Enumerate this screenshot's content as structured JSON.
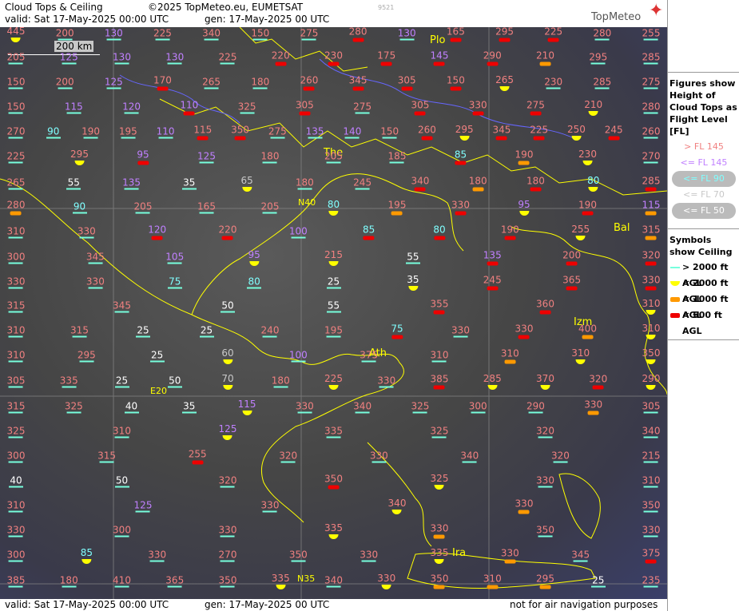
{
  "header": {
    "title": "Cloud Tops & Ceiling",
    "copyright": "©2025 TopMeteo.eu, EUMETSAT",
    "valid": "valid:  Sat  17-May-2025  00:00 UTC",
    "gen": "gen: 17-May-2025 00 UTC",
    "code": "9521",
    "brand": "TopMeteo"
  },
  "footer": {
    "valid": "valid:  Sat  17-May-2025  00:00 UTC",
    "gen": "gen: 17-May-2025 00 UTC",
    "note": "not for air navigation purposes"
  },
  "map": {
    "scale_label": "200 km",
    "cities": [
      "Plo",
      "The",
      "Ath",
      "Izm",
      "Bal",
      "Ira"
    ],
    "grid_labels": [
      "N40",
      "E20",
      "N35"
    ]
  },
  "legend": {
    "heights_title": "Figures show Height of Cloud Tops as Flight Level  [FL]",
    "heights": [
      {
        "label": "> FL 145",
        "color": "#f08080",
        "pill": false
      },
      {
        "label": "<= FL 145",
        "color": "#c080ff",
        "pill": false
      },
      {
        "label": "<= FL 90",
        "color": "#80ffff",
        "pill": true
      },
      {
        "label": "<= FL 70",
        "color": "#c8c8c8",
        "pill": false
      },
      {
        "label": "<= FL 50",
        "color": "#ffffff",
        "pill": true
      }
    ],
    "symbols_title": "Symbols show Ceiling",
    "symbols": [
      {
        "label": "> 2000 ft AGL",
        "color": "#7fd",
        "shape": "line"
      },
      {
        "label": "< 2000 ft AGL",
        "color": "#ff0",
        "shape": "dot"
      },
      {
        "label": "< 1000 ft AGL",
        "color": "#f90",
        "shape": "sq"
      },
      {
        "label": "< 500 ft AGL",
        "color": "#e00",
        "shape": "sq"
      }
    ]
  },
  "cells": [
    {
      "v": "445",
      "c": "hi",
      "s": "y"
    },
    {
      "v": "200",
      "c": "hi",
      "s": "l"
    },
    {
      "v": "130",
      "c": "mid",
      "s": "l"
    },
    {
      "v": "225",
      "c": "hi",
      "s": "l"
    },
    {
      "v": "340",
      "c": "hi",
      "s": "l"
    },
    {
      "v": "150",
      "c": "hi",
      "s": "l"
    },
    {
      "v": "275",
      "c": "hi",
      "s": "l"
    },
    {
      "v": "280",
      "c": "hi",
      "s": "r"
    },
    {
      "v": "130",
      "c": "mid",
      "s": "l"
    },
    {
      "v": "165",
      "c": "hi",
      "s": "r"
    },
    {
      "v": "295",
      "c": "hi",
      "s": "r"
    },
    {
      "v": "225",
      "c": "hi",
      "s": "r"
    },
    {
      "v": "280",
      "c": "hi",
      "s": "l"
    },
    {
      "v": "255",
      "c": "hi",
      "s": "l"
    },
    {
      "v": "205",
      "c": "hi",
      "s": "l"
    },
    {
      "v": "125",
      "c": "mid",
      "s": "l"
    },
    {
      "v": "130",
      "c": "mid",
      "s": "l"
    },
    {
      "v": "130",
      "c": "mid",
      "s": "l"
    },
    {
      "v": "225",
      "c": "hi",
      "s": "l"
    },
    {
      "v": "220",
      "c": "hi",
      "s": "r"
    },
    {
      "v": "230",
      "c": "hi",
      "s": "r"
    },
    {
      "v": "175",
      "c": "hi",
      "s": "r"
    },
    {
      "v": "145",
      "c": "mid",
      "s": "r"
    },
    {
      "v": "290",
      "c": "hi",
      "s": "r"
    },
    {
      "v": "210",
      "c": "hi",
      "s": "o"
    },
    {
      "v": "295",
      "c": "hi",
      "s": "l"
    },
    {
      "v": "285",
      "c": "hi",
      "s": "l"
    },
    {
      "v": "150",
      "c": "hi",
      "s": "l"
    },
    {
      "v": "200",
      "c": "hi",
      "s": "l"
    },
    {
      "v": "125",
      "c": "mid",
      "s": "l"
    },
    {
      "v": "170",
      "c": "hi",
      "s": "r"
    },
    {
      "v": "265",
      "c": "hi",
      "s": "l"
    },
    {
      "v": "180",
      "c": "hi",
      "s": "l"
    },
    {
      "v": "260",
      "c": "hi",
      "s": "r"
    },
    {
      "v": "345",
      "c": "hi",
      "s": "r"
    },
    {
      "v": "305",
      "c": "hi",
      "s": "r"
    },
    {
      "v": "150",
      "c": "hi",
      "s": "r"
    },
    {
      "v": "265",
      "c": "hi",
      "s": "y"
    },
    {
      "v": "230",
      "c": "hi",
      "s": "l"
    },
    {
      "v": "285",
      "c": "hi",
      "s": "l"
    },
    {
      "v": "275",
      "c": "hi",
      "s": "l"
    },
    {
      "v": "150",
      "c": "hi",
      "s": "l"
    },
    {
      "v": "115",
      "c": "mid",
      "s": "l"
    },
    {
      "v": "120",
      "c": "mid",
      "s": "l"
    },
    {
      "v": "110",
      "c": "mid",
      "s": "r"
    },
    {
      "v": "325",
      "c": "hi",
      "s": "l"
    },
    {
      "v": "305",
      "c": "hi",
      "s": "r"
    },
    {
      "v": "275",
      "c": "hi",
      "s": "l"
    },
    {
      "v": "305",
      "c": "hi",
      "s": "r"
    },
    {
      "v": "330",
      "c": "hi",
      "s": "r"
    },
    {
      "v": "275",
      "c": "hi",
      "s": "r"
    },
    {
      "v": "210",
      "c": "hi",
      "s": "y"
    },
    {
      "v": "280",
      "c": "hi",
      "s": "l"
    },
    {
      "v": "270",
      "c": "hi",
      "s": "l"
    },
    {
      "v": "90",
      "c": "low",
      "s": "l"
    },
    {
      "v": "190",
      "c": "hi",
      "s": "l"
    },
    {
      "v": "195",
      "c": "hi",
      "s": "l"
    },
    {
      "v": "110",
      "c": "mid",
      "s": "l"
    },
    {
      "v": "115",
      "c": "hi",
      "s": "r"
    },
    {
      "v": "350",
      "c": "hi",
      "s": "r"
    },
    {
      "v": "275",
      "c": "hi",
      "s": "l"
    },
    {
      "v": "135",
      "c": "mid",
      "s": "l"
    },
    {
      "v": "140",
      "c": "mid",
      "s": "l"
    },
    {
      "v": "150",
      "c": "hi",
      "s": "l"
    },
    {
      "v": "260",
      "c": "hi",
      "s": "r"
    },
    {
      "v": "295",
      "c": "hi",
      "s": "y"
    },
    {
      "v": "345",
      "c": "hi",
      "s": "r"
    },
    {
      "v": "225",
      "c": "hi",
      "s": "r"
    },
    {
      "v": "250",
      "c": "hi",
      "s": "y"
    },
    {
      "v": "245",
      "c": "hi",
      "s": "r"
    },
    {
      "v": "260",
      "c": "hi",
      "s": "l"
    },
    {
      "v": "225",
      "c": "hi",
      "s": "l"
    },
    {
      "v": "295",
      "c": "hi",
      "s": "y"
    },
    {
      "v": "95",
      "c": "mid",
      "s": "r"
    },
    {
      "v": "125",
      "c": "mid",
      "s": "l"
    },
    {
      "v": "180",
      "c": "hi",
      "s": "l"
    },
    {
      "v": "205",
      "c": "hi",
      "s": "l"
    },
    {
      "v": "185",
      "c": "hi",
      "s": "l"
    },
    {
      "v": "85",
      "c": "low",
      "s": "r"
    },
    {
      "v": "190",
      "c": "hi",
      "s": "o"
    },
    {
      "v": "230",
      "c": "hi",
      "s": "y"
    },
    {
      "v": "270",
      "c": "hi",
      "s": "l"
    },
    {
      "v": "265",
      "c": "hi",
      "s": "l"
    },
    {
      "v": "55",
      "c": "white",
      "s": "l"
    },
    {
      "v": "135",
      "c": "mid",
      "s": "l"
    },
    {
      "v": "35",
      "c": "white",
      "s": "l"
    },
    {
      "v": "65",
      "c": "gray",
      "s": "y"
    },
    {
      "v": "180",
      "c": "hi",
      "s": "l"
    },
    {
      "v": "245",
      "c": "hi",
      "s": "l"
    },
    {
      "v": "340",
      "c": "hi",
      "s": "r"
    },
    {
      "v": "180",
      "c": "hi",
      "s": "o"
    },
    {
      "v": "180",
      "c": "hi",
      "s": "r"
    },
    {
      "v": "80",
      "c": "low",
      "s": "y"
    },
    {
      "v": "285",
      "c": "hi",
      "s": "r"
    },
    {
      "v": "280",
      "c": "hi",
      "s": "o"
    },
    {
      "v": "90",
      "c": "low",
      "s": "l"
    },
    {
      "v": "205",
      "c": "hi",
      "s": "l"
    },
    {
      "v": "165",
      "c": "hi",
      "s": "l"
    },
    {
      "v": "205",
      "c": "hi",
      "s": "l"
    },
    {
      "v": "80",
      "c": "low",
      "s": "y"
    },
    {
      "v": "195",
      "c": "hi",
      "s": "o"
    },
    {
      "v": "330",
      "c": "hi",
      "s": "r"
    },
    {
      "v": "95",
      "c": "mid",
      "s": "y"
    },
    {
      "v": "190",
      "c": "hi",
      "s": "r"
    },
    {
      "v": "115",
      "c": "mid",
      "s": "o"
    },
    {
      "v": "310",
      "c": "hi",
      "s": "l"
    },
    {
      "v": "330",
      "c": "hi",
      "s": "l"
    },
    {
      "v": "120",
      "c": "mid",
      "s": "r"
    },
    {
      "v": "220",
      "c": "hi",
      "s": "r"
    },
    {
      "v": "100",
      "c": "mid",
      "s": "l"
    },
    {
      "v": "85",
      "c": "low",
      "s": "r"
    },
    {
      "v": "80",
      "c": "low",
      "s": "r"
    },
    {
      "v": "190",
      "c": "hi",
      "s": "r"
    },
    {
      "v": "255",
      "c": "hi",
      "s": "y"
    },
    {
      "v": "315",
      "c": "hi",
      "s": "o"
    },
    {
      "v": "300",
      "c": "hi",
      "s": "l"
    },
    {
      "v": "345",
      "c": "hi",
      "s": "l"
    },
    {
      "v": "105",
      "c": "mid",
      "s": "l"
    },
    {
      "v": "95",
      "c": "mid",
      "s": "y"
    },
    {
      "v": "215",
      "c": "hi",
      "s": "y"
    },
    {
      "v": "55",
      "c": "white",
      "s": "l"
    },
    {
      "v": "135",
      "c": "mid",
      "s": "r"
    },
    {
      "v": "200",
      "c": "hi",
      "s": "r"
    },
    {
      "v": "320",
      "c": "hi",
      "s": "r"
    },
    {
      "v": "330",
      "c": "hi",
      "s": "l"
    },
    {
      "v": "330",
      "c": "hi",
      "s": "l"
    },
    {
      "v": "75",
      "c": "low",
      "s": "l"
    },
    {
      "v": "80",
      "c": "low",
      "s": "l"
    },
    {
      "v": "25",
      "c": "white",
      "s": "l"
    },
    {
      "v": "35",
      "c": "white",
      "s": "y"
    },
    {
      "v": "245",
      "c": "hi",
      "s": "r"
    },
    {
      "v": "365",
      "c": "hi",
      "s": "r"
    },
    {
      "v": "330",
      "c": "hi",
      "s": "r"
    },
    {
      "v": "315",
      "c": "hi",
      "s": "l"
    },
    {
      "v": "345",
      "c": "hi",
      "s": "l"
    },
    {
      "v": "50",
      "c": "white",
      "s": "l"
    },
    {
      "v": "55",
      "c": "white",
      "s": "l"
    },
    {
      "v": "355",
      "c": "hi",
      "s": "r"
    },
    {
      "v": "360",
      "c": "hi",
      "s": "r"
    },
    {
      "v": "310",
      "c": "hi",
      "s": "y"
    },
    {
      "v": "310",
      "c": "hi",
      "s": "l"
    },
    {
      "v": "315",
      "c": "hi",
      "s": "l"
    },
    {
      "v": "25",
      "c": "white",
      "s": "l"
    },
    {
      "v": "25",
      "c": "white",
      "s": "l"
    },
    {
      "v": "240",
      "c": "hi",
      "s": "l"
    },
    {
      "v": "195",
      "c": "hi",
      "s": "l"
    },
    {
      "v": "75",
      "c": "low",
      "s": "r"
    },
    {
      "v": "330",
      "c": "hi",
      "s": "l"
    },
    {
      "v": "330",
      "c": "hi",
      "s": "r"
    },
    {
      "v": "400",
      "c": "hi",
      "s": "o"
    },
    {
      "v": "310",
      "c": "hi",
      "s": "y"
    },
    {
      "v": "310",
      "c": "hi",
      "s": "l"
    },
    {
      "v": "295",
      "c": "hi",
      "s": "l"
    },
    {
      "v": "25",
      "c": "white",
      "s": "l"
    },
    {
      "v": "60",
      "c": "gray",
      "s": "y"
    },
    {
      "v": "100",
      "c": "mid",
      "s": "l"
    },
    {
      "v": "375",
      "c": "hi",
      "s": "l"
    },
    {
      "v": "310",
      "c": "hi",
      "s": "l"
    },
    {
      "v": "310",
      "c": "hi",
      "s": "o"
    },
    {
      "v": "310",
      "c": "hi",
      "s": "y"
    },
    {
      "v": "350",
      "c": "hi",
      "s": "y"
    },
    {
      "v": "305",
      "c": "hi",
      "s": "l"
    },
    {
      "v": "335",
      "c": "hi",
      "s": "l"
    },
    {
      "v": "25",
      "c": "white",
      "s": "l"
    },
    {
      "v": "50",
      "c": "white",
      "s": "l"
    },
    {
      "v": "70",
      "c": "gray",
      "s": "y"
    },
    {
      "v": "180",
      "c": "hi",
      "s": "l"
    },
    {
      "v": "225",
      "c": "hi",
      "s": "y"
    },
    {
      "v": "330",
      "c": "hi",
      "s": "l"
    },
    {
      "v": "385",
      "c": "hi",
      "s": "r"
    },
    {
      "v": "285",
      "c": "hi",
      "s": "y"
    },
    {
      "v": "370",
      "c": "hi",
      "s": "y"
    },
    {
      "v": "320",
      "c": "hi",
      "s": "r"
    },
    {
      "v": "290",
      "c": "hi",
      "s": "y"
    },
    {
      "v": "315",
      "c": "hi",
      "s": "l"
    },
    {
      "v": "325",
      "c": "hi",
      "s": "l"
    },
    {
      "v": "40",
      "c": "white",
      "s": "l"
    },
    {
      "v": "35",
      "c": "white",
      "s": "l"
    },
    {
      "v": "115",
      "c": "mid",
      "s": "y"
    },
    {
      "v": "330",
      "c": "hi",
      "s": "l"
    },
    {
      "v": "340",
      "c": "hi",
      "s": "l"
    },
    {
      "v": "325",
      "c": "hi",
      "s": "l"
    },
    {
      "v": "300",
      "c": "hi",
      "s": "l"
    },
    {
      "v": "290",
      "c": "hi",
      "s": "l"
    },
    {
      "v": "330",
      "c": "hi",
      "s": "o"
    },
    {
      "v": "305",
      "c": "hi",
      "s": "l"
    },
    {
      "v": "325",
      "c": "hi",
      "s": "l"
    },
    {
      "v": "310",
      "c": "hi",
      "s": "l"
    },
    {
      "v": "125",
      "c": "mid",
      "s": "y"
    },
    {
      "v": "335",
      "c": "hi",
      "s": "l"
    },
    {
      "v": "325",
      "c": "hi",
      "s": "l"
    },
    {
      "v": "320",
      "c": "hi",
      "s": "l"
    },
    {
      "v": "340",
      "c": "hi",
      "s": "l"
    },
    {
      "v": "300",
      "c": "hi",
      "s": "l"
    },
    {
      "v": "315",
      "c": "hi",
      "s": "l"
    },
    {
      "v": "255",
      "c": "hi",
      "s": "r"
    },
    {
      "v": "320",
      "c": "hi",
      "s": "l"
    },
    {
      "v": "330",
      "c": "hi",
      "s": "l"
    },
    {
      "v": "340",
      "c": "hi",
      "s": "l"
    },
    {
      "v": "320",
      "c": "hi",
      "s": "l"
    },
    {
      "v": "215",
      "c": "hi",
      "s": "l"
    },
    {
      "v": "40",
      "c": "white",
      "s": "l"
    },
    {
      "v": "50",
      "c": "white",
      "s": "l"
    },
    {
      "v": "320",
      "c": "hi",
      "s": "l"
    },
    {
      "v": "350",
      "c": "hi",
      "s": "r"
    },
    {
      "v": "325",
      "c": "hi",
      "s": "y"
    },
    {
      "v": "330",
      "c": "hi",
      "s": "l"
    },
    {
      "v": "310",
      "c": "hi",
      "s": "l"
    },
    {
      "v": "310",
      "c": "hi",
      "s": "l"
    },
    {
      "v": "125",
      "c": "mid",
      "s": "l"
    },
    {
      "v": "330",
      "c": "hi",
      "s": "l"
    },
    {
      "v": "340",
      "c": "hi",
      "s": "y"
    },
    {
      "v": "330",
      "c": "hi",
      "s": "o"
    },
    {
      "v": "350",
      "c": "hi",
      "s": "l"
    },
    {
      "v": "330",
      "c": "hi",
      "s": "l"
    },
    {
      "v": "300",
      "c": "hi",
      "s": "l"
    },
    {
      "v": "330",
      "c": "hi",
      "s": "l"
    },
    {
      "v": "335",
      "c": "hi",
      "s": "y"
    },
    {
      "v": "330",
      "c": "hi",
      "s": "o"
    },
    {
      "v": "350",
      "c": "hi",
      "s": "l"
    },
    {
      "v": "330",
      "c": "hi",
      "s": "l"
    },
    {
      "v": "300",
      "c": "hi",
      "s": "l"
    },
    {
      "v": "85",
      "c": "low",
      "s": "y"
    },
    {
      "v": "330",
      "c": "hi",
      "s": "l"
    },
    {
      "v": "270",
      "c": "hi",
      "s": "l"
    },
    {
      "v": "350",
      "c": "hi",
      "s": "l"
    },
    {
      "v": "330",
      "c": "hi",
      "s": "l"
    },
    {
      "v": "335",
      "c": "hi",
      "s": "y"
    },
    {
      "v": "330",
      "c": "hi",
      "s": "o"
    },
    {
      "v": "345",
      "c": "hi",
      "s": "l"
    },
    {
      "v": "375",
      "c": "hi",
      "s": "r"
    },
    {
      "v": "385",
      "c": "hi",
      "s": "l"
    },
    {
      "v": "180",
      "c": "hi",
      "s": "l"
    },
    {
      "v": "410",
      "c": "hi",
      "s": "l"
    },
    {
      "v": "365",
      "c": "hi",
      "s": "l"
    },
    {
      "v": "350",
      "c": "hi",
      "s": "l"
    },
    {
      "v": "335",
      "c": "hi",
      "s": "y"
    },
    {
      "v": "340",
      "c": "hi",
      "s": "l"
    },
    {
      "v": "330",
      "c": "hi",
      "s": "y"
    },
    {
      "v": "350",
      "c": "hi",
      "s": "o"
    },
    {
      "v": "310",
      "c": "hi",
      "s": "o"
    },
    {
      "v": "295",
      "c": "hi",
      "s": "o"
    },
    {
      "v": "25",
      "c": "white",
      "s": "l"
    },
    {
      "v": "235",
      "c": "hi",
      "s": "l"
    },
    {
      "v": "275",
      "c": "hi",
      "s": "l"
    },
    {
      "v": "290",
      "c": "hi",
      "s": "r"
    }
  ]
}
